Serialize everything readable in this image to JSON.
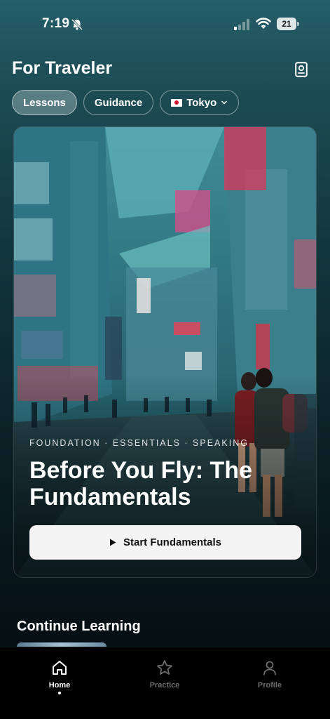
{
  "status_bar": {
    "time": "7:19",
    "battery": "21"
  },
  "header": {
    "title": "For Traveler"
  },
  "chips": [
    {
      "label": "Lessons",
      "active": true
    },
    {
      "label": "Guidance",
      "active": false
    },
    {
      "label": "Tokyo",
      "active": false
    }
  ],
  "hero": {
    "tags": "FOUNDATION · ESSENTIALS · SPEAKING",
    "title": "Before You Fly: The Fundamentals",
    "button_label": "Start Fundamentals"
  },
  "continue": {
    "title": "Continue Learning"
  },
  "tabs": [
    {
      "label": "Home",
      "active": true
    },
    {
      "label": "Practice",
      "active": false
    },
    {
      "label": "Profile",
      "active": false
    }
  ],
  "colors": {
    "accent": "#ffffff",
    "inactive_tab": "#6c6c6c",
    "button_bg": "#f4f4f4"
  }
}
